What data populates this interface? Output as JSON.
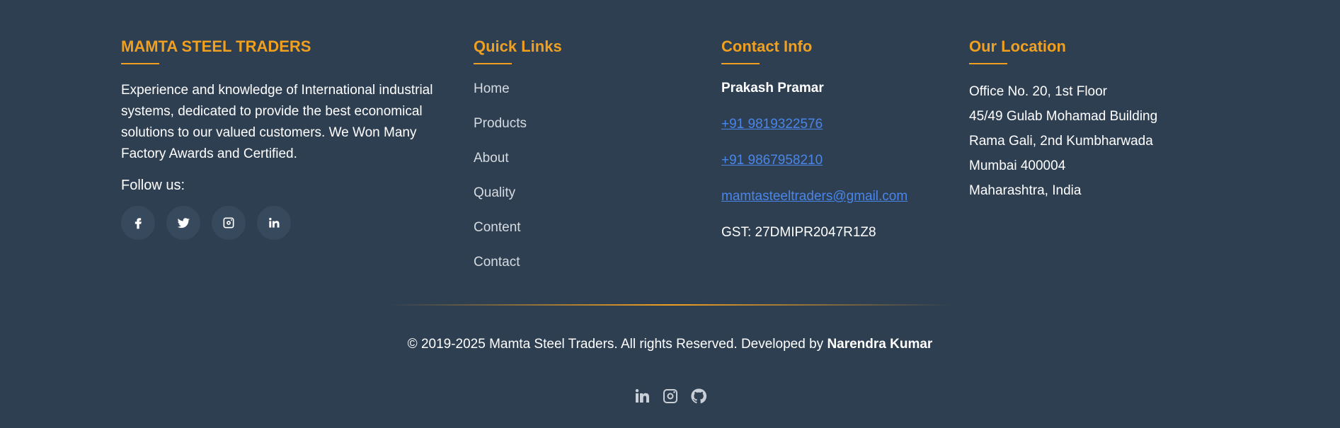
{
  "about": {
    "title": "MAMTA STEEL TRADERS",
    "text": "Experience and knowledge of International industrial systems, dedicated to provide the best economical solutions to our valued customers. We Won Many Factory Awards and Certified.",
    "follow_label": "Follow us:",
    "social_icons": [
      "facebook-icon",
      "twitter-icon",
      "instagram-icon",
      "linkedin-icon"
    ]
  },
  "quick_links": {
    "title": "Quick Links",
    "items": [
      "Home",
      "Products",
      "About",
      "Quality",
      "Content",
      "Contact"
    ]
  },
  "contact": {
    "title": "Contact Info",
    "name": "Prakash Pramar",
    "phone1": "+91 9819322576",
    "phone2": "+91 9867958210",
    "email": "mamtasteeltraders@gmail.com",
    "gst": "GST: 27DMIPR2047R1Z8"
  },
  "location": {
    "title": "Our Location",
    "lines": [
      "Office No. 20, 1st Floor",
      "45/49 Gulab Mohamad Building",
      "Rama Gali, 2nd Kumbharwada",
      "Mumbai 400004",
      "Maharashtra, India"
    ]
  },
  "footer": {
    "copyright": "© 2019-2025 Mamta Steel Traders. All rights Reserved. Developed by",
    "developer": "Narendra Kumar",
    "icons": [
      "linkedin-icon",
      "instagram-icon",
      "github-icon"
    ]
  },
  "colors": {
    "background": "#2e3f52",
    "accent": "#f0a020",
    "link": "#4a86e8"
  }
}
